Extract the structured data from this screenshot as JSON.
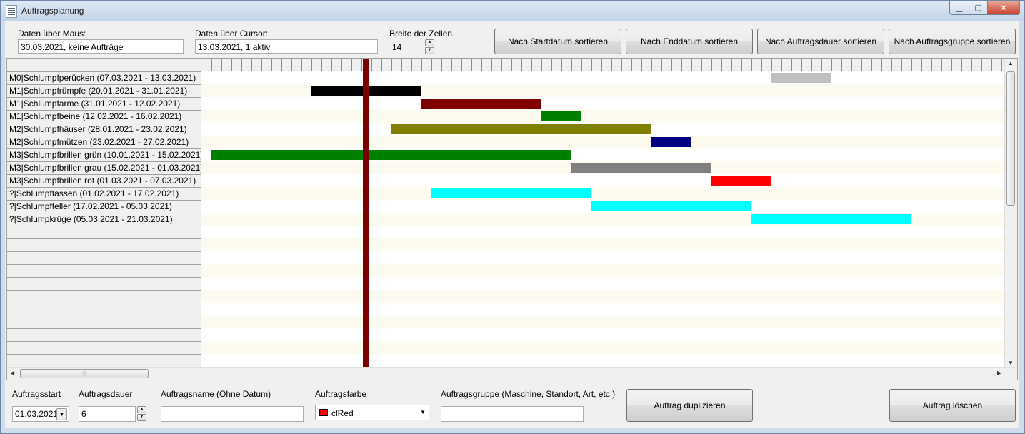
{
  "window": {
    "title": "Auftragsplanung",
    "close_glyph": "×",
    "colors": {
      "cursor_line": "#7a0000",
      "row_stripe": "#fdfaf0",
      "border": "#6f86a4"
    }
  },
  "top": {
    "mouse_label": "Daten über Maus:",
    "mouse_value": "30.03.2021, keine Aufträge",
    "cursor_label": "Daten über Cursor:",
    "cursor_value": "13.03.2021, 1 aktiv",
    "cellwidth_label": "Breite der Zellen",
    "cellwidth_value": "14",
    "buttons": {
      "sort_start": "Nach Startdatum sortieren",
      "sort_end": "Nach Enddatum sortieren",
      "sort_duration": "Nach Auftragsdauer sortieren",
      "sort_group": "Nach Auftragsgruppe sortieren"
    }
  },
  "orders": [
    {
      "label": "M0|Schlumpfperücken (07.03.2021 - 13.03.2021)",
      "start": "2021-03-07",
      "end": "2021-03-13",
      "color": "#c0c0c0"
    },
    {
      "label": "M1|Schlumpfrümpfe (20.01.2021 - 31.01.2021)",
      "start": "2021-01-20",
      "end": "2021-01-31",
      "color": "#000000"
    },
    {
      "label": "M1|Schlumpfarme (31.01.2021 - 12.02.2021)",
      "start": "2021-01-31",
      "end": "2021-02-12",
      "color": "#800000"
    },
    {
      "label": "M1|Schlumpfbeine (12.02.2021 - 16.02.2021)",
      "start": "2021-02-12",
      "end": "2021-02-16",
      "color": "#008000"
    },
    {
      "label": "M2|Schlumpfhäuser (28.01.2021 - 23.02.2021)",
      "start": "2021-01-28",
      "end": "2021-02-23",
      "color": "#808000"
    },
    {
      "label": "M2|Schlumpfmützen (23.02.2021 - 27.02.2021)",
      "start": "2021-02-23",
      "end": "2021-02-27",
      "color": "#000080"
    },
    {
      "label": "M3|Schlumpfbrillen grün (10.01.2021 - 15.02.2021)",
      "start": "2021-01-10",
      "end": "2021-02-15",
      "color": "#008000"
    },
    {
      "label": "M3|Schlumpfbrillen grau (15.02.2021 - 01.03.2021)",
      "start": "2021-02-15",
      "end": "2021-03-01",
      "color": "#808080"
    },
    {
      "label": "M3|Schlumpfbrillen rot (01.03.2021 - 07.03.2021)",
      "start": "2021-03-01",
      "end": "2021-03-07",
      "color": "#ff0000"
    },
    {
      "label": "?|Schlumpftassen (01.02.2021 - 17.02.2021)",
      "start": "2021-02-01",
      "end": "2021-02-17",
      "color": "#00ffff"
    },
    {
      "label": "?|Schlumpfteller (17.02.2021 - 05.03.2021)",
      "start": "2021-02-17",
      "end": "2021-03-05",
      "color": "#00ffff"
    },
    {
      "label": "?|Schlumpkrüge (05.03.2021 - 21.03.2021)",
      "start": "2021-03-05",
      "end": "2021-03-21",
      "color": "#00ffff"
    }
  ],
  "cursor_date": "2021-01-25",
  "bottom": {
    "start_label": "Auftragsstart",
    "start_value": "01.03.2021",
    "duration_label": "Auftragsdauer",
    "duration_value": "6",
    "name_label": "Auftragsname (Ohne Datum)",
    "name_value": "",
    "color_label": "Auftragsfarbe",
    "color_value": "clRed",
    "color_swatch": "#ff0000",
    "group_label": "Auftragsgruppe (Maschine, Standort, Art, etc.)",
    "group_value": "",
    "duplicate_button": "Auftrag duplizieren",
    "delete_button": "Auftrag löschen"
  }
}
